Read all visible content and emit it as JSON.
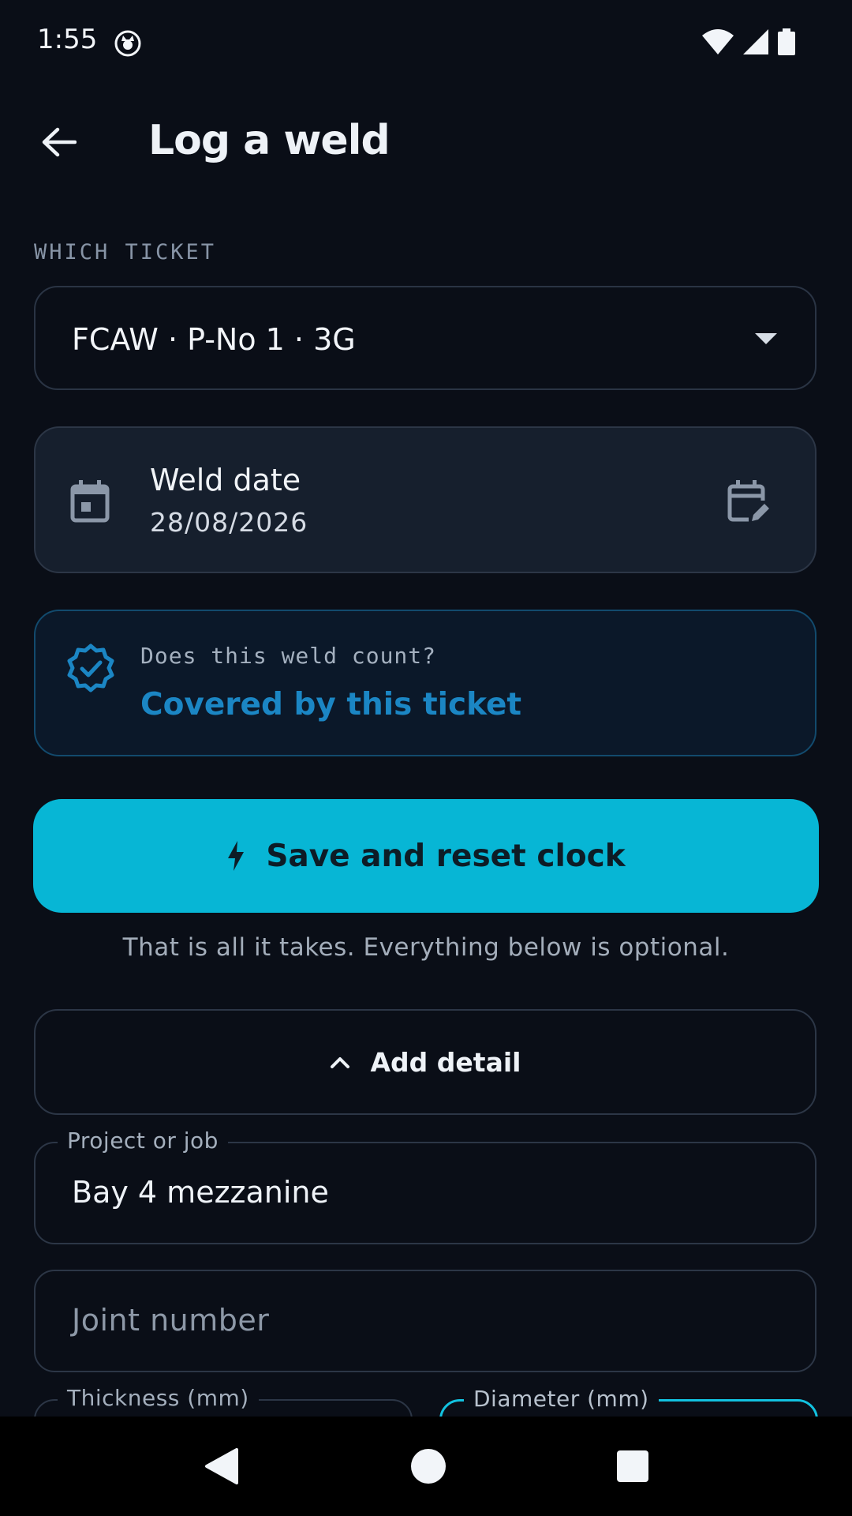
{
  "status_bar": {
    "time": "1:55",
    "icons": [
      "cat-app-icon",
      "wifi-icon",
      "signal-icon",
      "battery-icon"
    ]
  },
  "top_bar": {
    "title": "Log a weld",
    "back_icon": "arrow-left-icon"
  },
  "ticket_section": {
    "label": "WHICH TICKET",
    "selected": "FCAW · P-No 1 · 3G"
  },
  "weld_date": {
    "label": "Weld date",
    "value": "28/08/2026"
  },
  "coverage": {
    "question": "Does this weld count?",
    "answer": "Covered by this ticket"
  },
  "primary_action": {
    "label": "Save and reset clock",
    "helper": "That is all it takes. Everything below is optional."
  },
  "detail_toggle": {
    "label": "Add detail"
  },
  "fields": {
    "project": {
      "label": "Project or job",
      "value": "Bay 4 mezzanine"
    },
    "joint": {
      "placeholder": "Joint number"
    },
    "thickness": {
      "label": "Thickness (mm)"
    },
    "diameter": {
      "label": "Diameter (mm)"
    }
  },
  "colors": {
    "background": "#0a0e17",
    "accent": "#07b6d5",
    "covered_text": "#1b86c4",
    "card": "#161f2d"
  }
}
